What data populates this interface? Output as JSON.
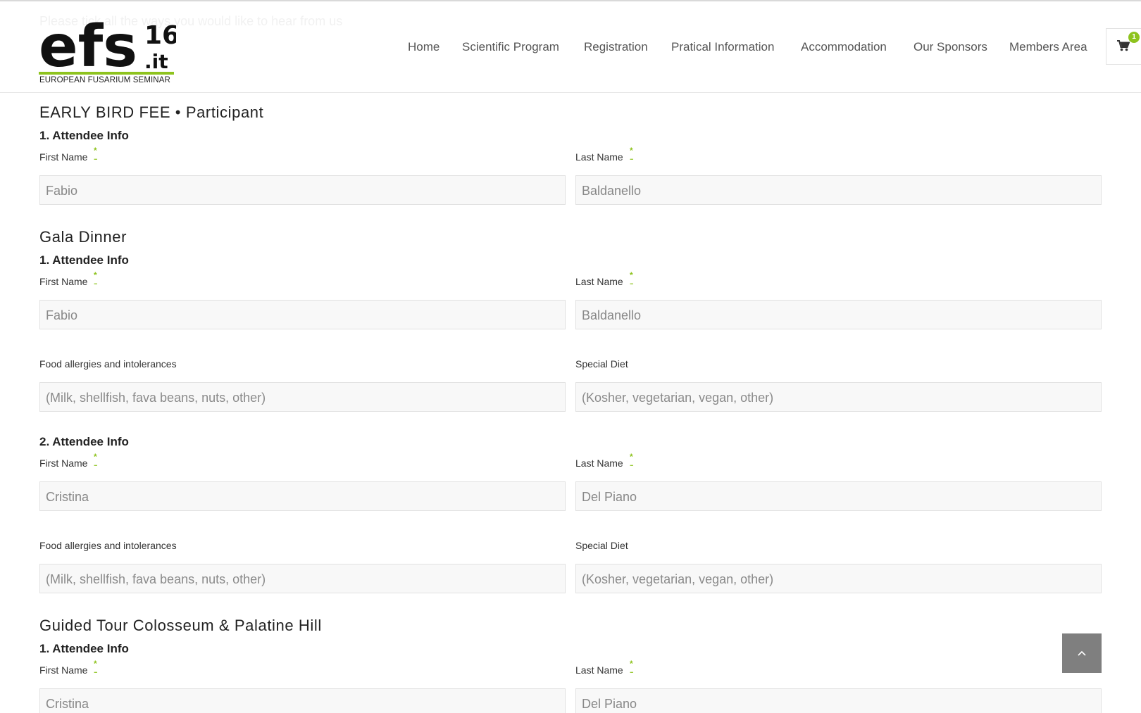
{
  "header": {
    "faded_text": "Please tick all the ways you would like to hear from us",
    "logo": {
      "text_main": "efs",
      "text_num": "16",
      "text_tld": ".it",
      "caption": "EUROPEAN FUSARIUM SEMINAR"
    },
    "nav": [
      "Home",
      "Scientific Program",
      "Registration",
      "Pratical Information",
      "Accommodation",
      "Our Sponsors",
      "Members Area"
    ],
    "cart": {
      "icon": "cart-icon",
      "count": "1"
    }
  },
  "colors": {
    "accent": "#8ec31e",
    "field_bg": "#f8f8f8",
    "scroll_top_bg": "#7f7f7f"
  },
  "sections": [
    {
      "title": "EARLY BIRD FEE • Participant",
      "attendees": [
        {
          "heading": "1. Attendee Info",
          "first_name_label": "First Name",
          "last_name_label": "Last Name",
          "first_name_value": "Fabio",
          "last_name_value": "Baldanello"
        }
      ]
    },
    {
      "title": "Gala Dinner",
      "attendees": [
        {
          "heading": "1. Attendee Info",
          "first_name_label": "First Name",
          "last_name_label": "Last Name",
          "first_name_value": "Fabio",
          "last_name_value": "Baldanello",
          "allergies_label": "Food allergies and intolerances",
          "allergies_placeholder": "(Milk, shellfish, fava beans, nuts, other)",
          "diet_label": "Special Diet",
          "diet_placeholder": "(Kosher, vegetarian, vegan, other)"
        },
        {
          "heading": "2. Attendee Info",
          "first_name_label": "First Name",
          "last_name_label": "Last Name",
          "first_name_value": "Cristina",
          "last_name_value": "Del Piano",
          "allergies_label": "Food allergies and intolerances",
          "allergies_placeholder": "(Milk, shellfish, fava beans, nuts, other)",
          "diet_label": "Special Diet",
          "diet_placeholder": "(Kosher, vegetarian, vegan, other)"
        }
      ]
    },
    {
      "title": "Guided Tour Colosseum & Palatine Hill",
      "attendees": [
        {
          "heading": "1. Attendee Info",
          "first_name_label": "First Name",
          "last_name_label": "Last Name",
          "first_name_value": "Cristina",
          "last_name_value": "Del Piano"
        }
      ]
    }
  ],
  "required_marker": "*",
  "scroll_top": {
    "icon": "chevron-up-icon"
  }
}
